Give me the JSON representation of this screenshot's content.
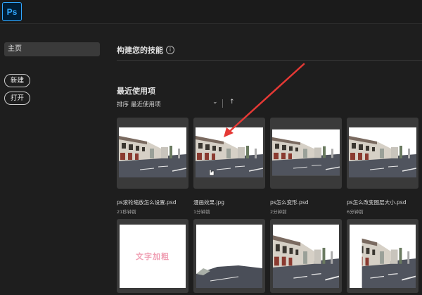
{
  "app": {
    "logo_text": "Ps"
  },
  "sidebar": {
    "home_label": "主页",
    "new_label": "新建",
    "open_label": "打开"
  },
  "main": {
    "skills_title": "构建您的技能",
    "info_icon": "info-icon",
    "recent_title": "最近使用项",
    "sort_label": "排序",
    "sort_value": "最近使用项"
  },
  "recent_files": [
    {
      "name": "ps滚轮缩放怎么设置.psd",
      "time": "21秒钟前"
    },
    {
      "name": "漫画效果.jpg",
      "time": "1分钟前"
    },
    {
      "name": "ps怎么变形.psd",
      "time": "2分钟前"
    },
    {
      "name": "ps怎么改变图层大小.psd",
      "time": "6分钟前"
    }
  ],
  "second_row": [
    {
      "thumb_text": "文字加粗"
    }
  ],
  "colors": {
    "accent": "#31a8ff",
    "arrow": "#e53935",
    "background": "#1e1e1e",
    "card": "#3a3a3a"
  }
}
